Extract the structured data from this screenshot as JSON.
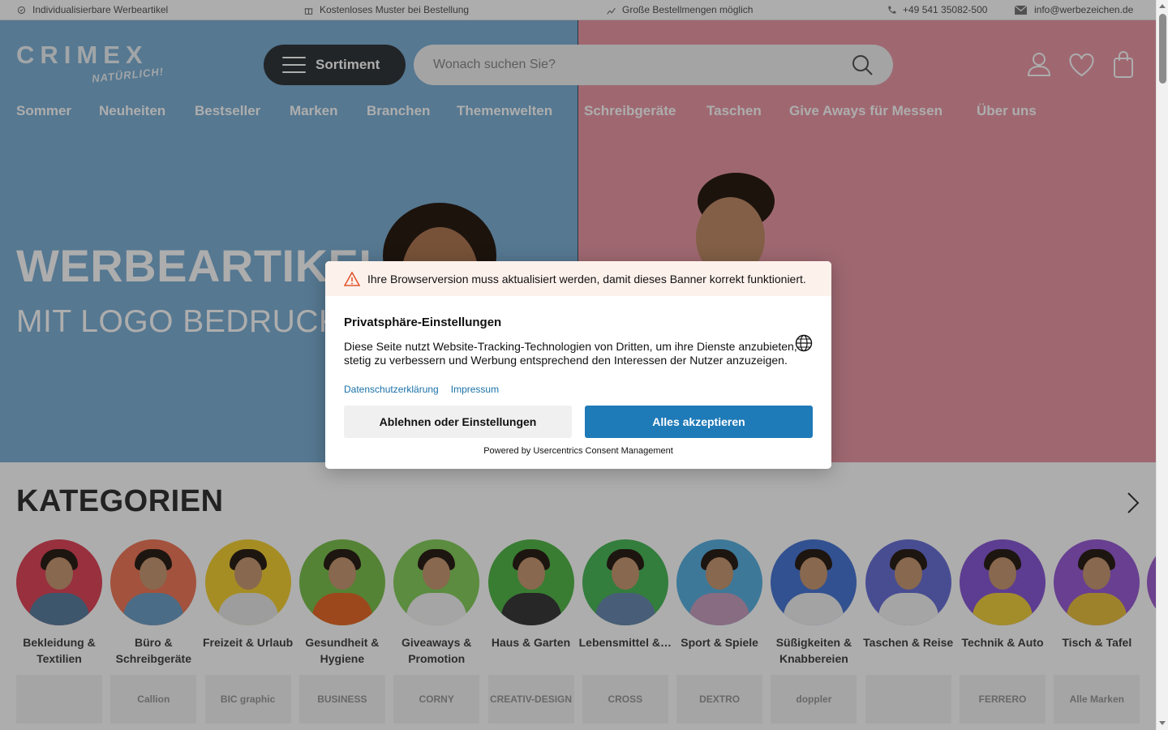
{
  "topbar": {
    "items": [
      {
        "icon": "badge-icon",
        "label": "Individualisierbare Werbeartikel"
      },
      {
        "icon": "gift-icon",
        "label": "Kostenloses Muster bei Bestellung"
      },
      {
        "icon": "chart-icon",
        "label": "Große Bestellmengen möglich"
      },
      {
        "icon": "phone-icon",
        "label": "+49 541 35082-500"
      },
      {
        "icon": "mail-icon",
        "label": "info@werbezeichen.de"
      }
    ]
  },
  "header": {
    "logo_word": "CRIMEX",
    "logo_tagline": "NATÜRLICH!",
    "sortiment_label": "Sortiment",
    "search_placeholder": "Wonach suchen Sie?",
    "icons": [
      "account-icon",
      "wishlist-heart-icon",
      "cart-bag-icon"
    ]
  },
  "nav": {
    "items": [
      "Sommer",
      "Neuheiten",
      "Bestseller",
      "Marken",
      "Branchen",
      "Themenwelten",
      "Schreibgeräte",
      "Taschen",
      "Give Aways für Messen",
      "Über uns"
    ]
  },
  "hero": {
    "title": "WERBEARTIKEL",
    "subtitle": "MIT LOGO BEDRUCKEN",
    "colors": {
      "left": "#7fb1d6",
      "right": "#ea9aa7"
    }
  },
  "categories": {
    "title": "KATEGORIEN",
    "items": [
      {
        "label": "Bekleidung & Textilien",
        "bg": "#e0485a"
      },
      {
        "label": "Büro & Schreibgeräte",
        "bg": "#f07a5a"
      },
      {
        "label": "Freizeit & Urlaub",
        "bg": "#f4d035"
      },
      {
        "label": "Gesundheit & Hygiene",
        "bg": "#7cc24e"
      },
      {
        "label": "Giveaways & Promotion",
        "bg": "#86cf5e"
      },
      {
        "label": "Haus & Garten",
        "bg": "#55b84a"
      },
      {
        "label": "Lebensmittel &…",
        "bg": "#4cb85a"
      },
      {
        "label": "Sport & Spiele",
        "bg": "#5ab2e2"
      },
      {
        "label": "Süßigkeiten & Knabbereien",
        "bg": "#4a78d6"
      },
      {
        "label": "Taschen & Reise",
        "bg": "#6a72d8"
      },
      {
        "label": "Technik & Auto",
        "bg": "#8a5ad6"
      },
      {
        "label": "Tisch & Tafel",
        "bg": "#9a5ed6"
      }
    ]
  },
  "brands": {
    "items": [
      "",
      "Callion",
      "BIC graphic",
      "BUSINESS",
      "CORNY",
      "CREATIV-DESIGN",
      "CROSS",
      "DEXTRO",
      "doppler",
      "",
      "FERRERO",
      "Alle Marken"
    ]
  },
  "consent": {
    "warning": "Ihre Browserversion muss aktualisiert werden, damit dieses Banner korrekt funktioniert.",
    "title": "Privatsphäre-Einstellungen",
    "text": "Diese Seite nutzt Website-Tracking-Technologien von Dritten, um ihre Dienste anzubieten, stetig zu verbessern und Werbung entsprechend den Interessen der Nutzer anzuzeigen.",
    "link_privacy": "Datenschutzerklärung",
    "link_imprint": "Impressum",
    "deny_label": "Ablehnen oder Einstellungen",
    "accept_label": "Alles akzeptieren",
    "powered": "Powered by Usercentrics Consent Management",
    "accent": "#1f7ab8"
  }
}
